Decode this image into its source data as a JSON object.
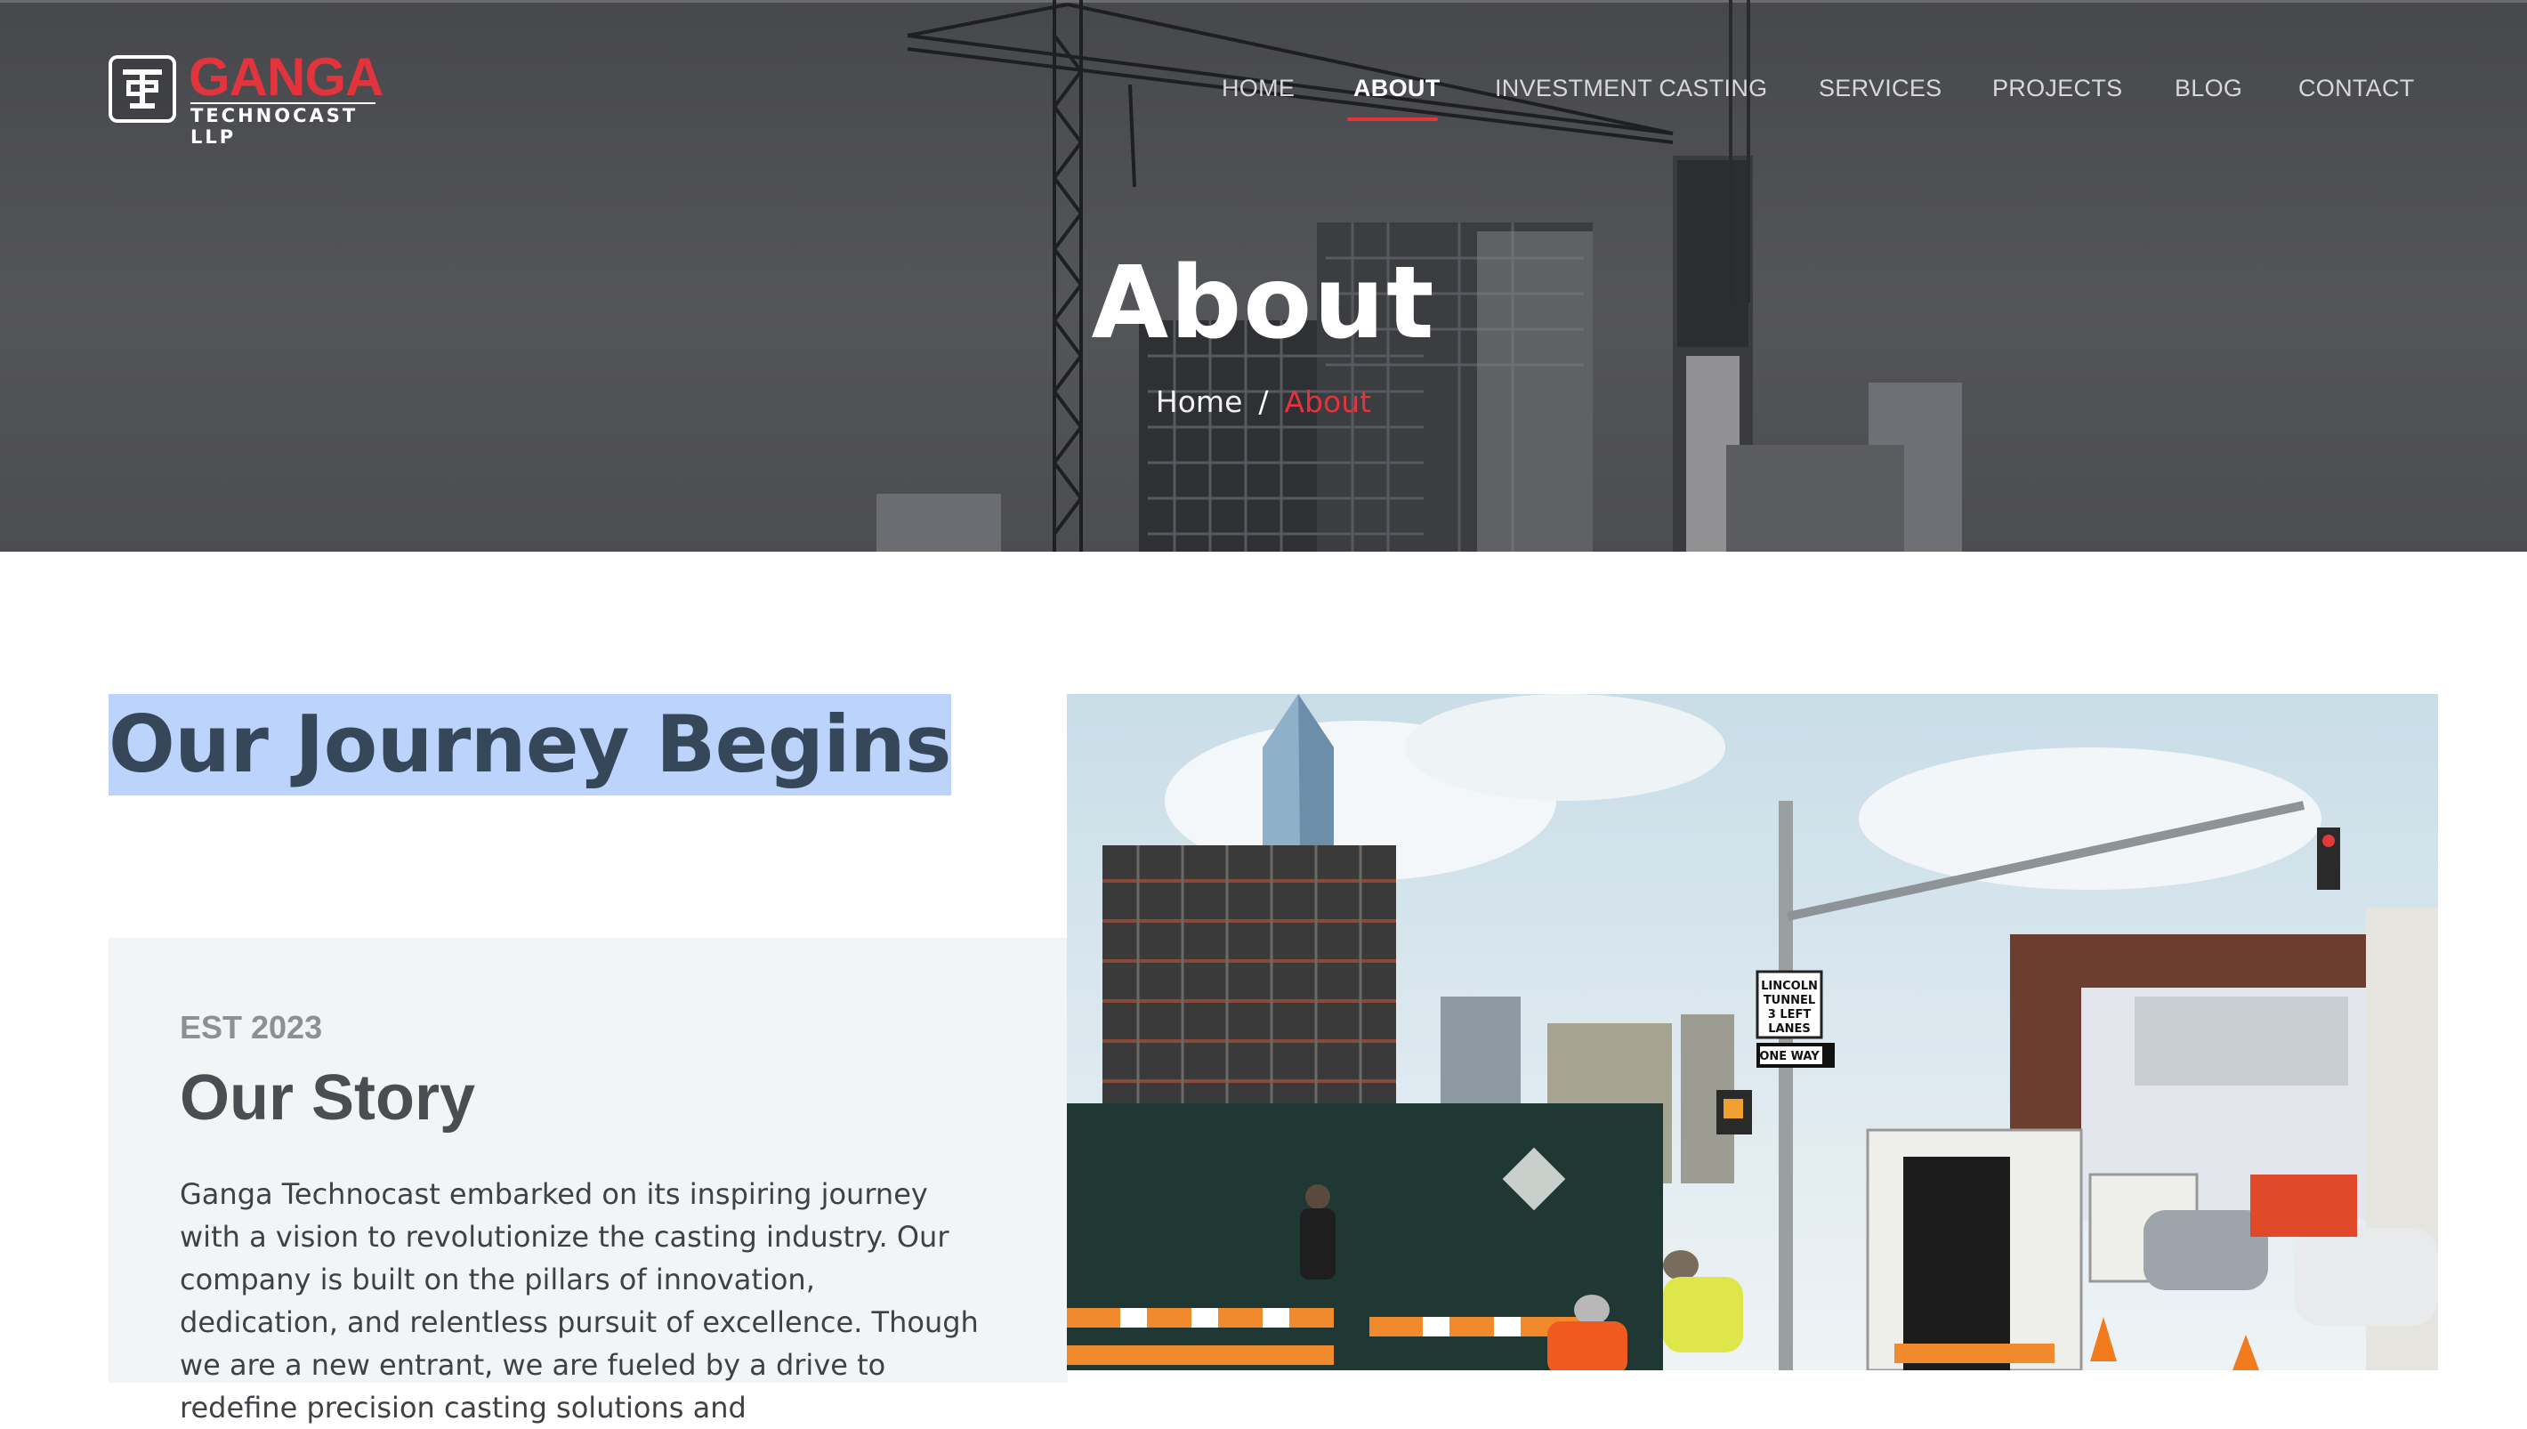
{
  "brand": {
    "name": "GANGA",
    "subtitle": "TECHNOCAST LLP",
    "colors": {
      "accent": "#e1343d",
      "heading": "#36475a",
      "highlight": "#bcd3fb"
    }
  },
  "nav": {
    "items": [
      {
        "label": "HOME",
        "active": false
      },
      {
        "label": "ABOUT",
        "active": true
      },
      {
        "label": "INVESTMENT CASTING",
        "active": false
      },
      {
        "label": "SERVICES",
        "active": false
      },
      {
        "label": "PROJECTS",
        "active": false
      },
      {
        "label": "BLOG",
        "active": false
      },
      {
        "label": "CONTACT",
        "active": false
      }
    ]
  },
  "hero": {
    "title": "About",
    "breadcrumb": {
      "home": "Home",
      "separator": "/",
      "current": "About"
    }
  },
  "main": {
    "heading": "Our Journey Begins",
    "story": {
      "eyebrow": "EST 2023",
      "title": "Our Story",
      "body": "Ganga Technocast embarked on its inspiring journey with a vision to revolutionize the casting industry. Our company is built on the pillars of innovation, dedication, and relentless pursuit of excellence. Though we are a new entrant, we are fueled by a drive to redefine precision casting solutions and"
    },
    "photo": {
      "signs": {
        "tunnel": [
          "LINCOLN",
          "TUNNEL",
          "3 LEFT",
          "LANES"
        ],
        "one_way": "ONE WAY"
      }
    }
  }
}
